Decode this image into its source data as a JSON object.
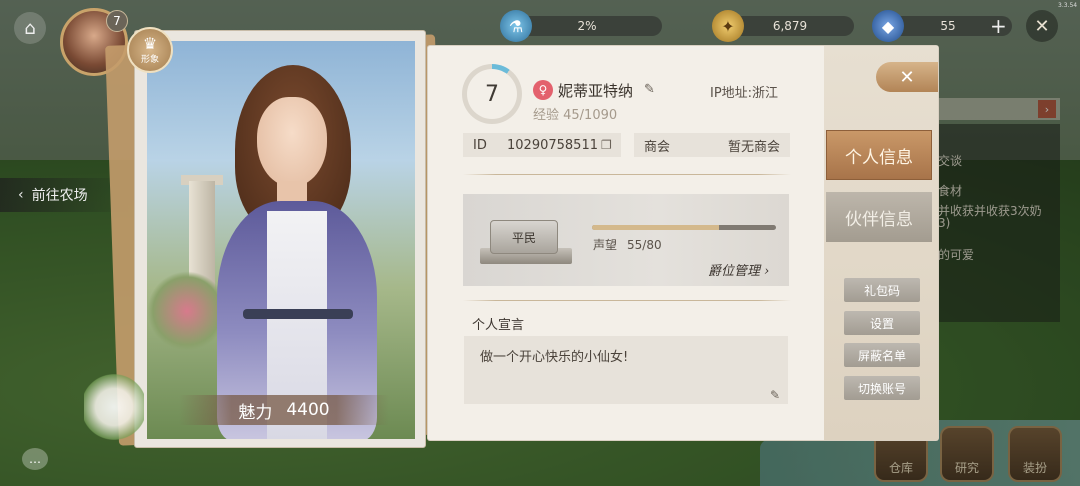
{
  "hud": {
    "level": "7",
    "exp_percent": "2%",
    "gold": "6,879",
    "gems": "55",
    "plus": "+",
    "version": "3.3.54"
  },
  "nav": {
    "goto_farm": "前往农场"
  },
  "portrait": {
    "badge_label": "形象",
    "charm_label": "魅力",
    "charm_value": "4400"
  },
  "profile": {
    "level": "7",
    "level_progress": 0.1,
    "name": "妮蒂亚特纳",
    "ip": "IP地址:浙江",
    "exp": "经验 45/1090",
    "id_label": "ID",
    "id_value": "10290758511",
    "guild_label": "商会",
    "guild_value": "暂无商会"
  },
  "rank": {
    "title": "平民",
    "prestige_label": "声望",
    "prestige_value": "55/80",
    "prestige_progress": 0.6875,
    "manage": "爵位管理"
  },
  "declaration": {
    "title": "个人宣言",
    "text": "做一个开心快乐的小仙女!"
  },
  "tabs": {
    "personal": "个人信息",
    "partner": "伙伴信息"
  },
  "side_buttons": [
    "礼包码",
    "设置",
    "屏蔽名单",
    "切换账号"
  ],
  "quests": [
    "交谈",
    "食材",
    "并收获并收获3次奶",
    "3)",
    "的可爱"
  ],
  "bottom": [
    "仓库",
    "研究",
    "装扮"
  ],
  "colors": {
    "accent_blue": "#6bbbd9",
    "tab_active": "#b07a4c",
    "female": "#e3616d"
  }
}
